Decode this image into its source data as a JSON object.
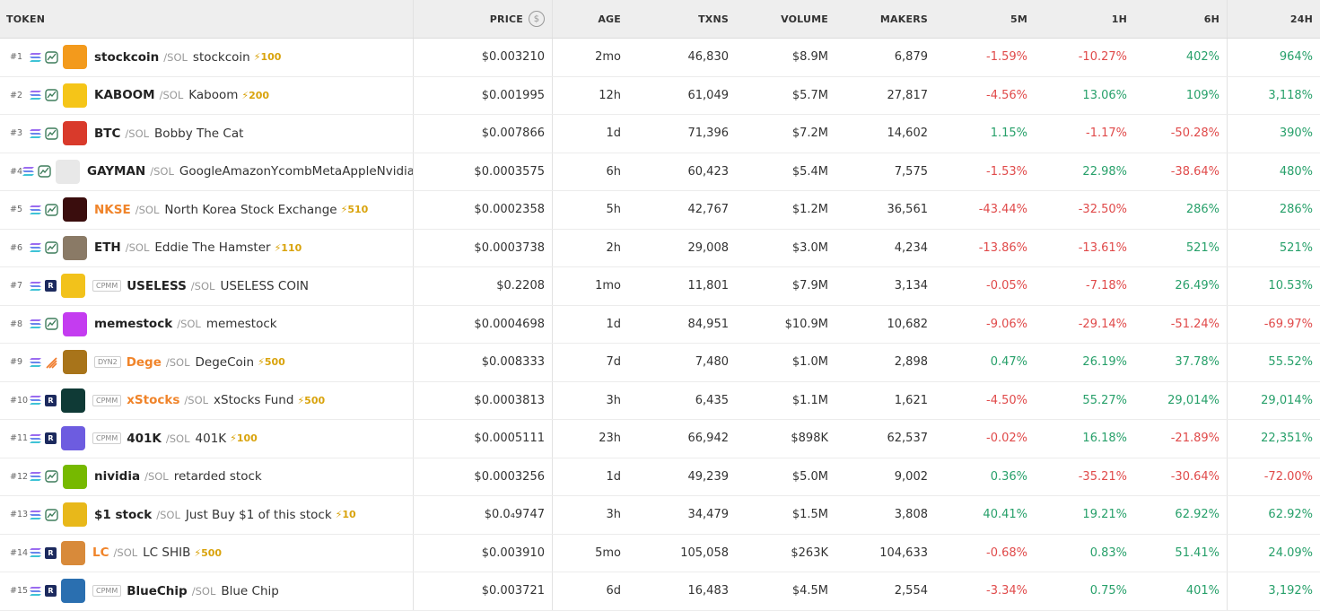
{
  "columns": {
    "token": "TOKEN",
    "price": "PRICE",
    "age": "AGE",
    "txns": "TXNS",
    "volume": "VOLUME",
    "makers": "MAKERS",
    "m5": "5M",
    "h1": "1H",
    "h6": "6H",
    "h24": "24H"
  },
  "colors": {
    "negative": "#e04a4a",
    "positive": "#27a06a",
    "boost": "#d9a30c",
    "orange_symbol": "#f0842a"
  },
  "rows": [
    {
      "rank": "#1",
      "badge": "",
      "symbol": "stockcoin",
      "quote": "/SOL",
      "name": "stockcoin",
      "boost": "⚡100",
      "price": "$0.003210",
      "age": "2mo",
      "txns": "46,830",
      "volume": "$8.9M",
      "makers": "6,879",
      "m5": "-1.59%",
      "h1": "-10.27%",
      "h6": "402%",
      "h24": "964%",
      "avatar": "#f39a1c",
      "symbol_color": "dark",
      "dex": "pump"
    },
    {
      "rank": "#2",
      "badge": "",
      "symbol": "KABOOM",
      "quote": "/SOL",
      "name": "Kaboom",
      "boost": "⚡200",
      "price": "$0.001995",
      "age": "12h",
      "txns": "61,049",
      "volume": "$5.7M",
      "makers": "27,817",
      "m5": "-4.56%",
      "h1": "13.06%",
      "h6": "109%",
      "h24": "3,118%",
      "avatar": "#f5c518",
      "symbol_color": "dark",
      "dex": "pump"
    },
    {
      "rank": "#3",
      "badge": "",
      "symbol": "BTC",
      "quote": "/SOL",
      "name": "Bobby The Cat",
      "boost": "",
      "price": "$0.007866",
      "age": "1d",
      "txns": "71,396",
      "volume": "$7.2M",
      "makers": "14,602",
      "m5": "1.15%",
      "h1": "-1.17%",
      "h6": "-50.28%",
      "h24": "390%",
      "avatar": "#d93a2b",
      "symbol_color": "dark",
      "dex": "pump"
    },
    {
      "rank": "#4",
      "badge": "",
      "symbol": "GAYMAN",
      "quote": "/SOL",
      "name": "GoogleAmazonYcombMetaAppleNvidia",
      "boost": "",
      "price": "$0.0003575",
      "age": "6h",
      "txns": "60,423",
      "volume": "$5.4M",
      "makers": "7,575",
      "m5": "-1.53%",
      "h1": "22.98%",
      "h6": "-38.64%",
      "h24": "480%",
      "avatar": "#e8e8e8",
      "symbol_color": "dark",
      "dex": "pump"
    },
    {
      "rank": "#5",
      "badge": "",
      "symbol": "NKSE",
      "quote": "/SOL",
      "name": "North Korea Stock Exchange",
      "boost": "⚡510",
      "price": "$0.0002358",
      "age": "5h",
      "txns": "42,767",
      "volume": "$1.2M",
      "makers": "36,561",
      "m5": "-43.44%",
      "h1": "-32.50%",
      "h6": "286%",
      "h24": "286%",
      "avatar": "#3a0d0d",
      "symbol_color": "orange",
      "dex": "pump"
    },
    {
      "rank": "#6",
      "badge": "",
      "symbol": "ETH",
      "quote": "/SOL",
      "name": "Eddie The Hamster",
      "boost": "⚡110",
      "price": "$0.0003738",
      "age": "2h",
      "txns": "29,008",
      "volume": "$3.0M",
      "makers": "4,234",
      "m5": "-13.86%",
      "h1": "-13.61%",
      "h6": "521%",
      "h24": "521%",
      "avatar": "#8a7a66",
      "symbol_color": "dark",
      "dex": "pump"
    },
    {
      "rank": "#7",
      "badge": "CPMM",
      "symbol": "USELESS",
      "quote": "/SOL",
      "name": "USELESS COIN",
      "boost": "",
      "price": "$0.2208",
      "age": "1mo",
      "txns": "11,801",
      "volume": "$7.9M",
      "makers": "3,134",
      "m5": "-0.05%",
      "h1": "-7.18%",
      "h6": "26.49%",
      "h24": "10.53%",
      "avatar": "#f2c21b",
      "symbol_color": "dark",
      "dex": "ray"
    },
    {
      "rank": "#8",
      "badge": "",
      "symbol": "memestock",
      "quote": "/SOL",
      "name": "memestock",
      "boost": "",
      "price": "$0.0004698",
      "age": "1d",
      "txns": "84,951",
      "volume": "$10.9M",
      "makers": "10,682",
      "m5": "-9.06%",
      "h1": "-29.14%",
      "h6": "-51.24%",
      "h24": "-69.97%",
      "avatar": "#c43cf0",
      "symbol_color": "dark",
      "dex": "pump"
    },
    {
      "rank": "#9",
      "badge": "DYN2",
      "symbol": "Dege",
      "quote": "/SOL",
      "name": "DegeCoin",
      "boost": "⚡500",
      "price": "$0.008333",
      "age": "7d",
      "txns": "7,480",
      "volume": "$1.0M",
      "makers": "2,898",
      "m5": "0.47%",
      "h1": "26.19%",
      "h6": "37.78%",
      "h24": "55.52%",
      "avatar": "#a8741a",
      "symbol_color": "orange",
      "dex": "meteora"
    },
    {
      "rank": "#10",
      "badge": "CPMM",
      "symbol": "xStocks",
      "quote": "/SOL",
      "name": "xStocks Fund",
      "boost": "⚡500",
      "price": "$0.0003813",
      "age": "3h",
      "txns": "6,435",
      "volume": "$1.1M",
      "makers": "1,621",
      "m5": "-4.50%",
      "h1": "55.27%",
      "h6": "29,014%",
      "h24": "29,014%",
      "avatar": "#0f3a36",
      "symbol_color": "orange",
      "dex": "ray"
    },
    {
      "rank": "#11",
      "badge": "CPMM",
      "symbol": "401K",
      "quote": "/SOL",
      "name": "401K",
      "boost": "⚡100",
      "price": "$0.0005111",
      "age": "23h",
      "txns": "66,942",
      "volume": "$898K",
      "makers": "62,537",
      "m5": "-0.02%",
      "h1": "16.18%",
      "h6": "-21.89%",
      "h24": "22,351%",
      "avatar": "#6d5ce0",
      "symbol_color": "dark",
      "dex": "ray"
    },
    {
      "rank": "#12",
      "badge": "",
      "symbol": "nividia",
      "quote": "/SOL",
      "name": "retarded stock",
      "boost": "",
      "price": "$0.0003256",
      "age": "1d",
      "txns": "49,239",
      "volume": "$5.0M",
      "makers": "9,002",
      "m5": "0.36%",
      "h1": "-35.21%",
      "h6": "-30.64%",
      "h24": "-72.00%",
      "avatar": "#76b900",
      "symbol_color": "dark",
      "dex": "pump"
    },
    {
      "rank": "#13",
      "badge": "",
      "symbol": "$1 stock",
      "quote": "/SOL",
      "name": "Just Buy $1 of this stock",
      "boost": "⚡10",
      "price": "$0.0₄9747",
      "age": "3h",
      "txns": "34,479",
      "volume": "$1.5M",
      "makers": "3,808",
      "m5": "40.41%",
      "h1": "19.21%",
      "h6": "62.92%",
      "h24": "62.92%",
      "avatar": "#e8b81a",
      "symbol_color": "dark",
      "dex": "pump"
    },
    {
      "rank": "#14",
      "badge": "",
      "symbol": "LC",
      "quote": "/SOL",
      "name": "LC SHIB",
      "boost": "⚡500",
      "price": "$0.003910",
      "age": "5mo",
      "txns": "105,058",
      "volume": "$263K",
      "makers": "104,633",
      "m5": "-0.68%",
      "h1": "0.83%",
      "h6": "51.41%",
      "h24": "24.09%",
      "avatar": "#d88a3a",
      "symbol_color": "orange",
      "dex": "ray"
    },
    {
      "rank": "#15",
      "badge": "CPMM",
      "symbol": "BlueChip",
      "quote": "/SOL",
      "name": "Blue Chip",
      "boost": "",
      "price": "$0.003721",
      "age": "6d",
      "txns": "16,483",
      "volume": "$4.5M",
      "makers": "2,554",
      "m5": "-3.34%",
      "h1": "0.75%",
      "h6": "401%",
      "h24": "3,192%",
      "avatar": "#2a6fb0",
      "symbol_color": "dark",
      "dex": "ray"
    }
  ]
}
